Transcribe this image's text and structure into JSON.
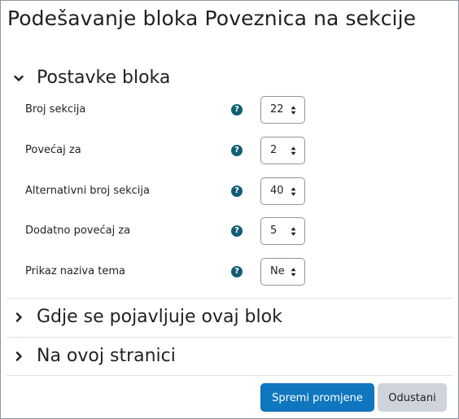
{
  "dialog": {
    "title": "Podešavanje bloka Poveznica na sekcije"
  },
  "sections": [
    {
      "title": "Postavke bloka",
      "expanded": true
    },
    {
      "title": "Gdje se pojavljuje ovaj blok",
      "expanded": false
    },
    {
      "title": "Na ovoj stranici",
      "expanded": false
    }
  ],
  "fields": [
    {
      "label": "Broj sekcija",
      "value": "22"
    },
    {
      "label": "Povećaj za",
      "value": "2"
    },
    {
      "label": "Alternativni broj sekcija",
      "value": "40"
    },
    {
      "label": "Dodatno povećaj za",
      "value": "5"
    },
    {
      "label": "Prikaz naziva tema",
      "value": "Ne"
    }
  ],
  "help_icon_glyph": "?",
  "buttons": {
    "save": "Spremi promjene",
    "cancel": "Odustani"
  },
  "colors": {
    "primary": "#0f6cbf",
    "help": "#115e74",
    "secondary": "#ced4da",
    "text": "#1d2125"
  }
}
